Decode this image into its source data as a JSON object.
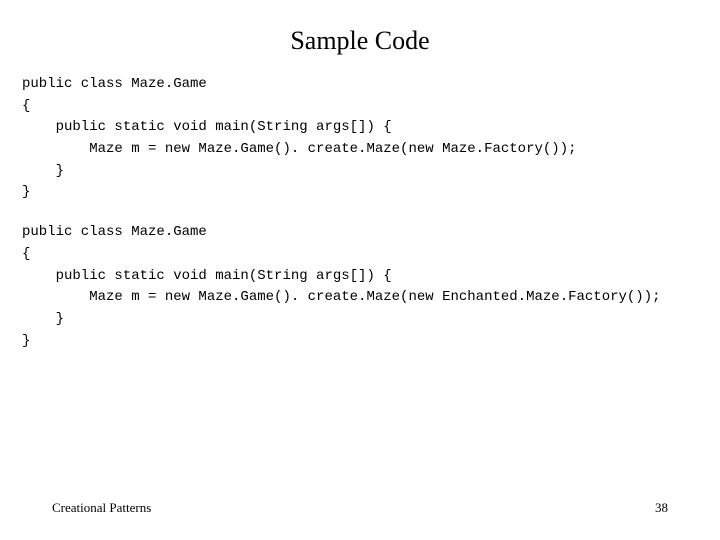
{
  "title": "Sample Code",
  "code_block_1": "public class Maze.Game\n{\n    public static void main(String args[]) {\n        Maze m = new Maze.Game(). create.Maze(new Maze.Factory());\n    }\n}",
  "code_block_2": "public class Maze.Game\n{\n    public static void main(String args[]) {\n        Maze m = new Maze.Game(). create.Maze(new Enchanted.Maze.Factory());\n    }\n}",
  "footer": {
    "left": "Creational Patterns",
    "page_number": "38"
  }
}
